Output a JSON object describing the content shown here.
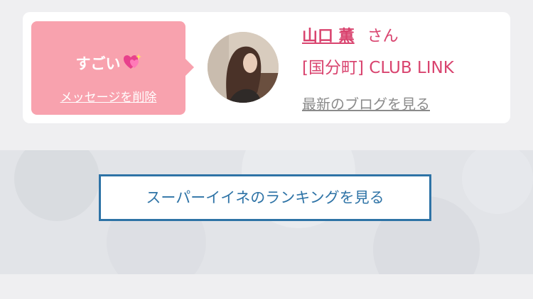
{
  "message": {
    "title": "すごい",
    "delete_label": "メッセージを削除"
  },
  "profile": {
    "name": "山口 薫",
    "honorific": "さん",
    "shop": "[国分町] CLUB LINK",
    "blog_link": "最新のブログを見る"
  },
  "ranking": {
    "button_label": "スーパーイイネのランキングを見る"
  },
  "colors": {
    "accent": "#d9446f",
    "bubble": "#f8a2ae",
    "button_border": "#2e73a6"
  },
  "icons": {
    "reaction": "sparkling-heart-icon"
  }
}
